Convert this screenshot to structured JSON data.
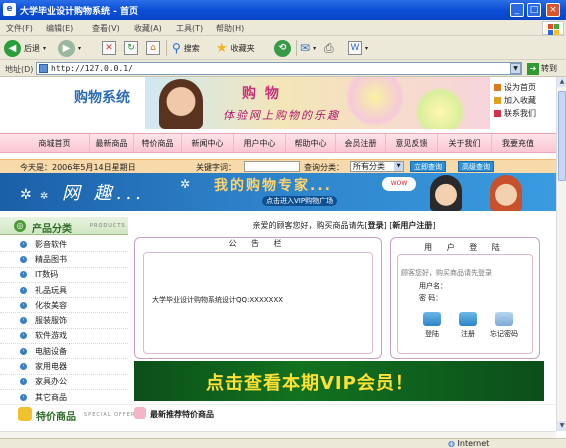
{
  "window": {
    "title": "大学毕业设计购物系统 - 首页",
    "min_btn": "_",
    "max_btn": "□",
    "close_btn": "×"
  },
  "menus": [
    "文件(F)",
    "编辑(E)",
    "查看(V)",
    "收藏(A)",
    "工具(T)",
    "帮助(H)"
  ],
  "toolbar": {
    "back": "后退",
    "search": "搜索",
    "favorites": "收藏夹"
  },
  "address": {
    "label": "地址(D)",
    "url": "http://127.0.0.1/",
    "go": "转到"
  },
  "site": {
    "logo": "购物系统",
    "banner_title": "购 物",
    "banner_slogan": "体验网上购物的乐趣",
    "toplinks": [
      "设为首页",
      "加入收藏",
      "联系我们"
    ]
  },
  "nav": [
    "商城首页",
    "最新商品",
    "特价商品",
    "新闻中心",
    "用户中心",
    "帮助中心",
    "会员注册",
    "意见反馈",
    "关于我们",
    "我要充值"
  ],
  "searchbar": {
    "date": "今天是：2006年5月14日星期日",
    "keyword_label": "关键字词：",
    "category_label": "查询分类：",
    "category_selected": "所有分类",
    "btn_search": "立即查询",
    "btn_advanced": "高级查询"
  },
  "vip_banner": {
    "text1": "网 趣...",
    "text2": "我的购物专家...",
    "text3": "点击进入VIP购物广场",
    "bubble": "WOW"
  },
  "categories": {
    "title": "产品分类",
    "title_en": "PRODUCTS",
    "items": [
      "影音软件",
      "精品图书",
      "IT数码",
      "礼品玩具",
      "化妆美容",
      "服装服饰",
      "软件游戏",
      "电脑设备",
      "家用电器",
      "家具办公",
      "其它商品"
    ]
  },
  "welcome": {
    "prefix": "亲爱的顾客您好，购买商品请先[",
    "login": "登录",
    "middle": "] [",
    "register": "新用户注册",
    "suffix": "]"
  },
  "notice": {
    "title": "公 告 栏",
    "text": "大学毕业设计购物系统设计QQ:XXXXXXX"
  },
  "userbox": {
    "title": "用 户 登 陆",
    "tip": "顾客您好，购买商品请先登录",
    "username_label": "用户名：",
    "password_label": "密  码：",
    "login": "登陆",
    "register": "注册",
    "forgot": "忘记密码"
  },
  "vip_strip": "点击查看本期VIP会员！",
  "specials": {
    "title": "特价商品",
    "title_en": "SPECIAL OFFER",
    "recommend": "最新推荐特价商品"
  },
  "status": {
    "zone": "Internet"
  },
  "colors": {
    "titlebar": "#0a4fd6",
    "nav_bg": "#fbc6d3",
    "search_bg": "#f8d9a9",
    "vip_green": "#12721f",
    "vip_yellow": "#ffe035",
    "logo_blue": "#2d6bb3"
  }
}
